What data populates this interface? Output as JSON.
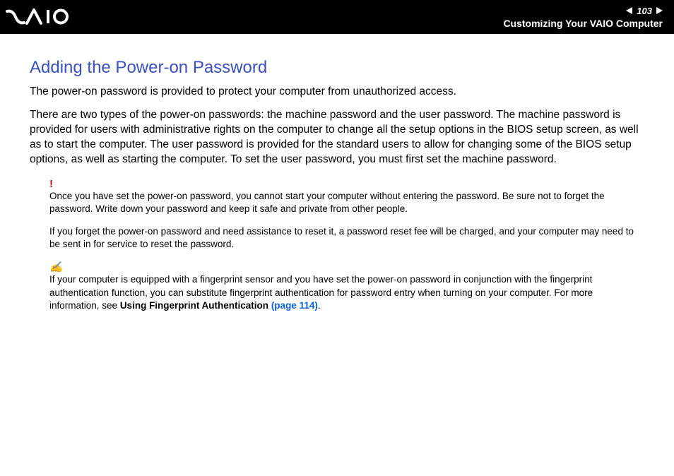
{
  "header": {
    "page_number": "103",
    "section": "Customizing Your VAIO Computer"
  },
  "title": "Adding the Power-on Password",
  "para1": "The power-on password is provided to protect your computer from unauthorized access.",
  "para2": "There are two types of the power-on passwords: the machine password and the user password. The machine password is provided for users with administrative rights on the computer to change all the setup options in the BIOS setup screen, as well as to start the computer. The user password is provided for the standard users to allow for changing some of the BIOS setup options, as well as starting the computer. To set the user password, you must first set the machine password.",
  "warning": {
    "icon": "!",
    "text1": "Once you have set the power-on password, you cannot start your computer without entering the password. Be sure not to forget the password. Write down your password and keep it safe and private from other people.",
    "text2": "If you forget the power-on password and need assistance to reset it, a password reset fee will be charged, and your computer may need to be sent in for service to reset the password."
  },
  "tip": {
    "icon": "✍",
    "text_pre": "If your computer is equipped with a fingerprint sensor and you have set the power-on password in conjunction with the fingerprint authentication function, you can substitute fingerprint authentication for password entry when turning on your computer. For more information, see ",
    "bold": "Using Fingerprint Authentication ",
    "link": "(page 114)",
    "text_post": "."
  }
}
